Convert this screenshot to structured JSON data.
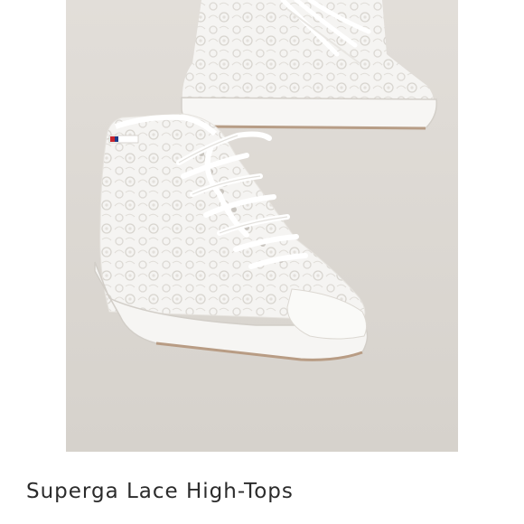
{
  "listing": {
    "title": "Superga Lace High-Tops",
    "brand_logo_text": "SUPERGA",
    "image_alt": "White lace high-top sneakers"
  },
  "colors": {
    "background": "#dedad5",
    "shoe": "#f4f3f1",
    "caption": "#2b2b2b"
  }
}
